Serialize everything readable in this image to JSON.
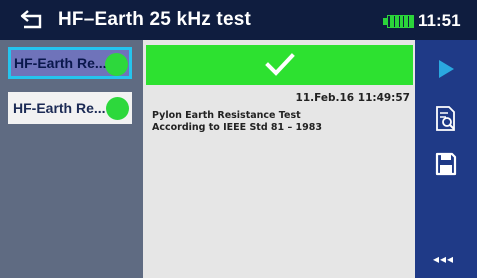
{
  "header": {
    "title": "HF–Earth 25 kHz test",
    "time": "11:51"
  },
  "list": {
    "items": [
      {
        "label": "HF-Earth Re...",
        "status": "pass",
        "selected": true
      },
      {
        "label": "HF-Earth Re...",
        "status": "pass",
        "selected": false
      }
    ]
  },
  "detail": {
    "result": "pass",
    "datetime": "11.Feb.16 11:49:57",
    "description_line1": "Pylon Earth Resistance Test",
    "description_line2": "According to IEEE Std 81 – 1983"
  },
  "toolbar": {
    "more_label": "◂◂◂"
  },
  "colors": {
    "header_bg": "#0f1d3f",
    "list_bg": "#5f6b82",
    "selected_item_bg": "#6f73ba",
    "selected_item_border": "#25c4ee",
    "pass_green": "#2de130",
    "toolbar_bg": "#1f3a87",
    "play_icon": "#2aa8e0"
  },
  "icons": [
    "back-arrow-icon",
    "battery-icon",
    "checkmark-icon",
    "play-icon",
    "view-details-icon",
    "save-icon",
    "more-icon"
  ]
}
